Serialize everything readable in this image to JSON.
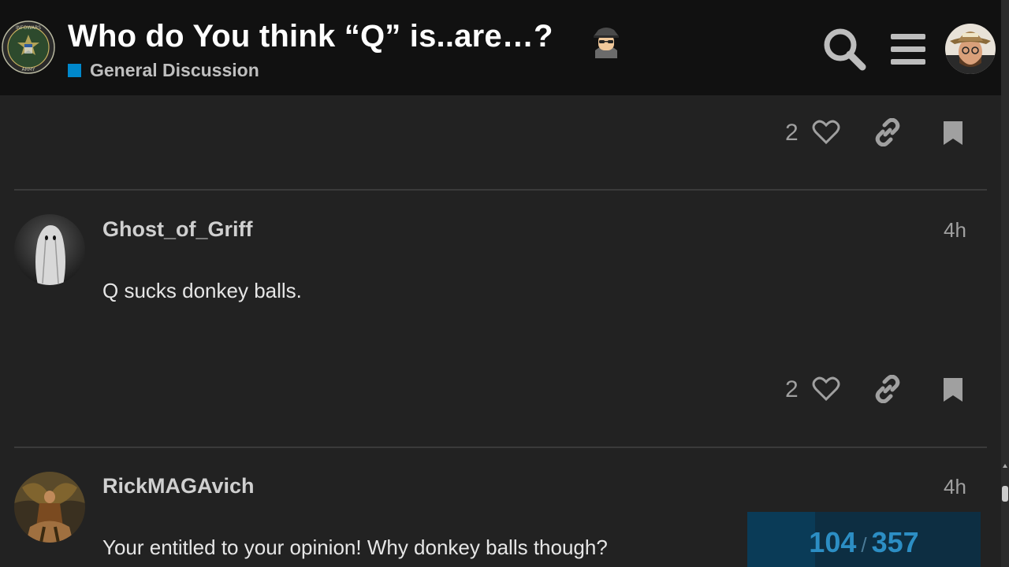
{
  "topic": {
    "title": "Who do You think “Q” is..are…?",
    "title_emoji": "detective-emoji",
    "category": "General Discussion",
    "category_color": "#0088cc"
  },
  "header": {
    "logo_text_top": "INFOWARS",
    "logo_text_bottom": "ARMY",
    "search_icon": "search-icon",
    "menu_icon": "hamburger-menu-icon",
    "user_avatar": "user-avatar"
  },
  "first_post_actions": {
    "likes": "2"
  },
  "posts": [
    {
      "username": "Ghost_of_Griff",
      "time": "4h",
      "body": "Q sucks donkey balls.",
      "likes": "2",
      "avatar": "ghost-avatar"
    },
    {
      "username": "RickMAGAvich",
      "time": "4h",
      "body": "Your entitled to your opinion! Why donkey balls though?",
      "avatar": "warrior-avatar"
    }
  ],
  "progress": {
    "current": "104",
    "separator": "/",
    "total": "357",
    "fraction": 0.291
  },
  "colors": {
    "background": "#222222",
    "header": "#111111",
    "accent": "#2c8ec4"
  }
}
